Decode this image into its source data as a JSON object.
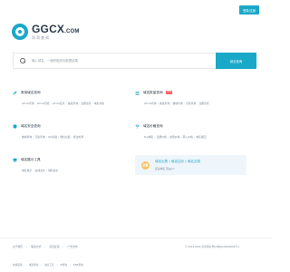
{
  "header": {
    "login_label": "登录/注册"
  },
  "logo": {
    "main": "GGCX",
    "suffix": ".COM",
    "sub": "哥哥查询"
  },
  "search": {
    "placeholder": "输入域名，一键获取综合数据结果",
    "button_label": "综合查询"
  },
  "categories": [
    {
      "title": "常用域名查询",
      "icon": "wrench-icon",
      "links": [
        "whois查询",
        "whois历史",
        "whois反查",
        "备案查询",
        "注册商查",
        "域名状态"
      ]
    },
    {
      "title": "域名批量查询",
      "icon": "list-icon",
      "badge": "HOT",
      "links": [
        "whois查询",
        "备案查询",
        "被墙查询",
        "污染查询",
        "注册商查"
      ]
    },
    {
      "title": "域名安全查询",
      "icon": "shield-icon",
      "links": [
        "被墙查询",
        "污染查询",
        "QQ拦截",
        "微信拦截",
        "抢注检测"
      ]
    },
    {
      "title": "域名价格查询",
      "icon": "wifi-icon",
      "links": [
        "Top域名",
        "注册价格",
        "续费价格",
        "转入价格",
        "域名赎回"
      ]
    },
    {
      "title": "域名展示工具",
      "icon": "monitor-icon",
      "links": [
        "域名展示",
        "在线交易",
        "域名估价"
      ]
    }
  ],
  "promo": {
    "icon_text": "出售",
    "title": "域名出售 | 域名估价 | 域名交易",
    "sub": "买卖域名 到ggcx"
  },
  "footer": {
    "links": [
      "关于我们",
      "联系方式",
      "意见反馈",
      "广告合作"
    ],
    "copyright": "© 2014-2024 哥哥查询  粤ICP备2024000000号-1",
    "friend_label": "友情链接：",
    "friend_links": [
      "域名查询",
      "站长工具",
      "IP查询",
      "DNS查询"
    ]
  },
  "colors": {
    "accent": "#1aa8c8",
    "hot": "#ff5a5a"
  }
}
